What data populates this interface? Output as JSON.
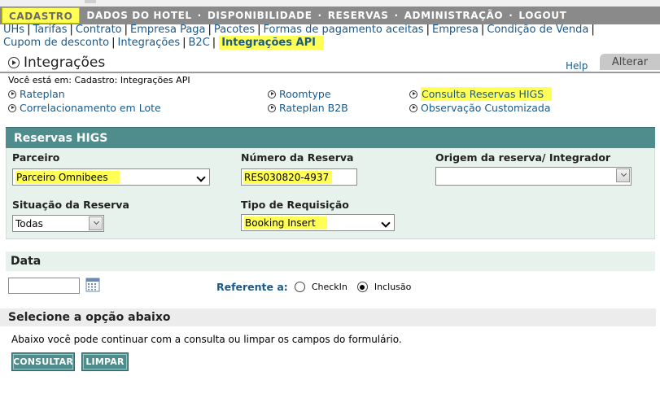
{
  "main_nav": {
    "items": [
      "CADASTRO",
      "DADOS DO HOTEL",
      "DISPONIBILIDADE",
      "RESERVAS",
      "ADMINISTRAÇÃO",
      "LOGOUT"
    ],
    "separator": "·",
    "active": "CADASTRO"
  },
  "sub_nav": {
    "items": [
      "UHs",
      "Tarifas",
      "Contrato",
      "Empresa Paga",
      "Pacotes",
      "Formas de pagamento aceitas",
      "Empresa",
      "Condição de Venda",
      "Cupom de desconto",
      "Integrações",
      "B2C"
    ],
    "current": "Integrações API",
    "separator": "|"
  },
  "title": {
    "text": "Integrações",
    "help": "Help",
    "alterar": "Alterar"
  },
  "breadcrumb": "Você está em: Cadastro: Integrações API",
  "quick_links": [
    "Rateplan",
    "Roomtype",
    "Consulta Reservas HIGS",
    "Correlacionamento em Lote",
    "Rateplan B2B",
    "Observação Customizada"
  ],
  "form": {
    "section_title": "Reservas HIGS",
    "parceiro": {
      "label": "Parceiro",
      "value": "Parceiro Omnibees"
    },
    "numero_reserva": {
      "label": "Número da Reserva",
      "value": "RES030820-4937"
    },
    "origem": {
      "label": "Origem da reserva/ Integrador",
      "value": ""
    },
    "situacao": {
      "label": "Situação da Reserva",
      "value": "Todas"
    },
    "tipo_requisicao": {
      "label": "Tipo de Requisição",
      "value": "Booking Insert"
    }
  },
  "data_section": {
    "title": "Data",
    "referente_label": "Referente a:",
    "options": [
      "CheckIn",
      "Inclusão"
    ],
    "selected": "Inclusão"
  },
  "options_section": {
    "title": "Selecione a opção abaixo",
    "description": "Abaixo você pode continuar com a consulta ou limpar os campos do formulário.",
    "consultar": "CONSULTAR",
    "limpar": "LIMPAR"
  },
  "colors": {
    "nav_gray": "#8a8a8a",
    "highlight": "#ffff55",
    "teal": "#4f8c8c",
    "panel": "#e8f2ec",
    "link": "#1a5a8a"
  }
}
